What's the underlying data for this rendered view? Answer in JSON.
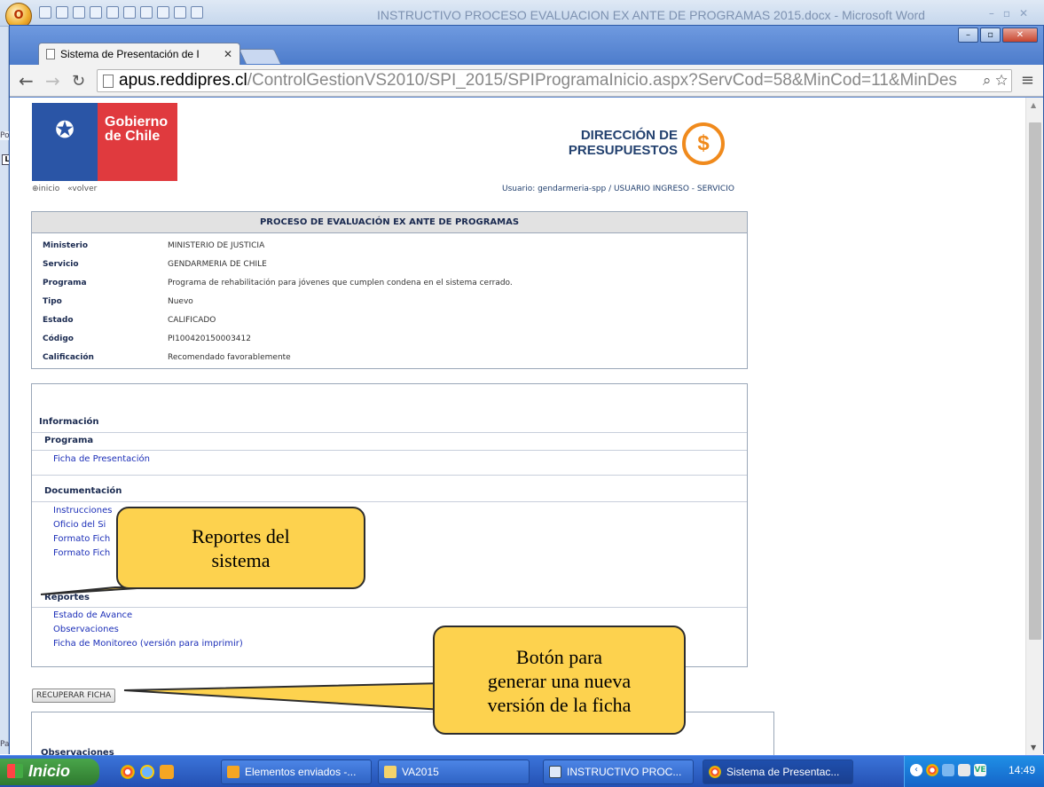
{
  "word": {
    "title": "INSTRUCTIVO PROCESO EVALUACION EX ANTE DE PROGRAMAS 2015.docx - Microsoft Word",
    "office_button": "O",
    "po_label": "Po",
    "l_label": "L",
    "pa_label": "Pa"
  },
  "browser": {
    "tab_title": "Sistema de Presentación de I",
    "url_host": "apus.reddipres.cl",
    "url_path": "/ControlGestionVS2010/SPI_2015/SPIProgramaInicio.aspx?ServCod=58&MinCod=11&MinDes"
  },
  "header": {
    "gobierno_line1": "Gobierno",
    "gobierno_line2": "de Chile",
    "dipres_line1": "DIRECCIÓN DE",
    "dipres_line2": "PRESUPUESTOS",
    "link_inicio": "⊕inicio",
    "link_volver": "«volver",
    "usuario": "Usuario: gendarmeria-spp / USUARIO INGRESO - SERVICIO"
  },
  "summary": {
    "title": "PROCESO DE EVALUACIÓN EX ANTE DE PROGRAMAS",
    "rows": [
      {
        "label": "Ministerio",
        "value": "MINISTERIO DE JUSTICIA"
      },
      {
        "label": "Servicio",
        "value": "GENDARMERIA DE CHILE"
      },
      {
        "label": "Programa",
        "value": "Programa de rehabilitación para jóvenes que cumplen condena en el sistema cerrado."
      },
      {
        "label": "Tipo",
        "value": "Nuevo"
      },
      {
        "label": "Estado",
        "value": "CALIFICADO"
      },
      {
        "label": "Código",
        "value": "PI100420150003412"
      },
      {
        "label": "Calificación",
        "value": "Recomendado favorablemente"
      }
    ]
  },
  "info": {
    "heading": "Información",
    "programa_heading": "Programa",
    "programa_links": [
      "Ficha de Presentación"
    ],
    "documentacion_heading": "Documentación",
    "documentacion_links": [
      "Instrucciones",
      "Oficio del Si",
      "Formato Fich",
      "Formato Fich"
    ],
    "reportes_heading": "Reportes",
    "reportes_links": [
      "Estado de Avance",
      "Observaciones",
      "Ficha de Monitoreo (versión para imprimir)"
    ]
  },
  "actions": {
    "recuperar_label": "RECUPERAR FICHA"
  },
  "observaciones_heading": "Observaciones",
  "callouts": {
    "reportes_line1": "Reportes del",
    "reportes_line2": "sistema",
    "boton_line1": "Botón para",
    "boton_line2": "generar una nueva",
    "boton_line3": "versión de la ficha"
  },
  "taskbar": {
    "start_label": "Inicio",
    "items": [
      "Elementos enviados -...",
      "VA2015",
      "INSTRUCTIVO PROC...",
      "Sistema de Presentac..."
    ],
    "tray_badge": "VE",
    "clock": "14:49"
  },
  "colors": {
    "gob_blue": "#2a55a6",
    "gob_red": "#e03a3e",
    "dipres_orange": "#f08a1c",
    "callout_fill": "#fdd24e",
    "link_blue": "#1c2fb8"
  }
}
